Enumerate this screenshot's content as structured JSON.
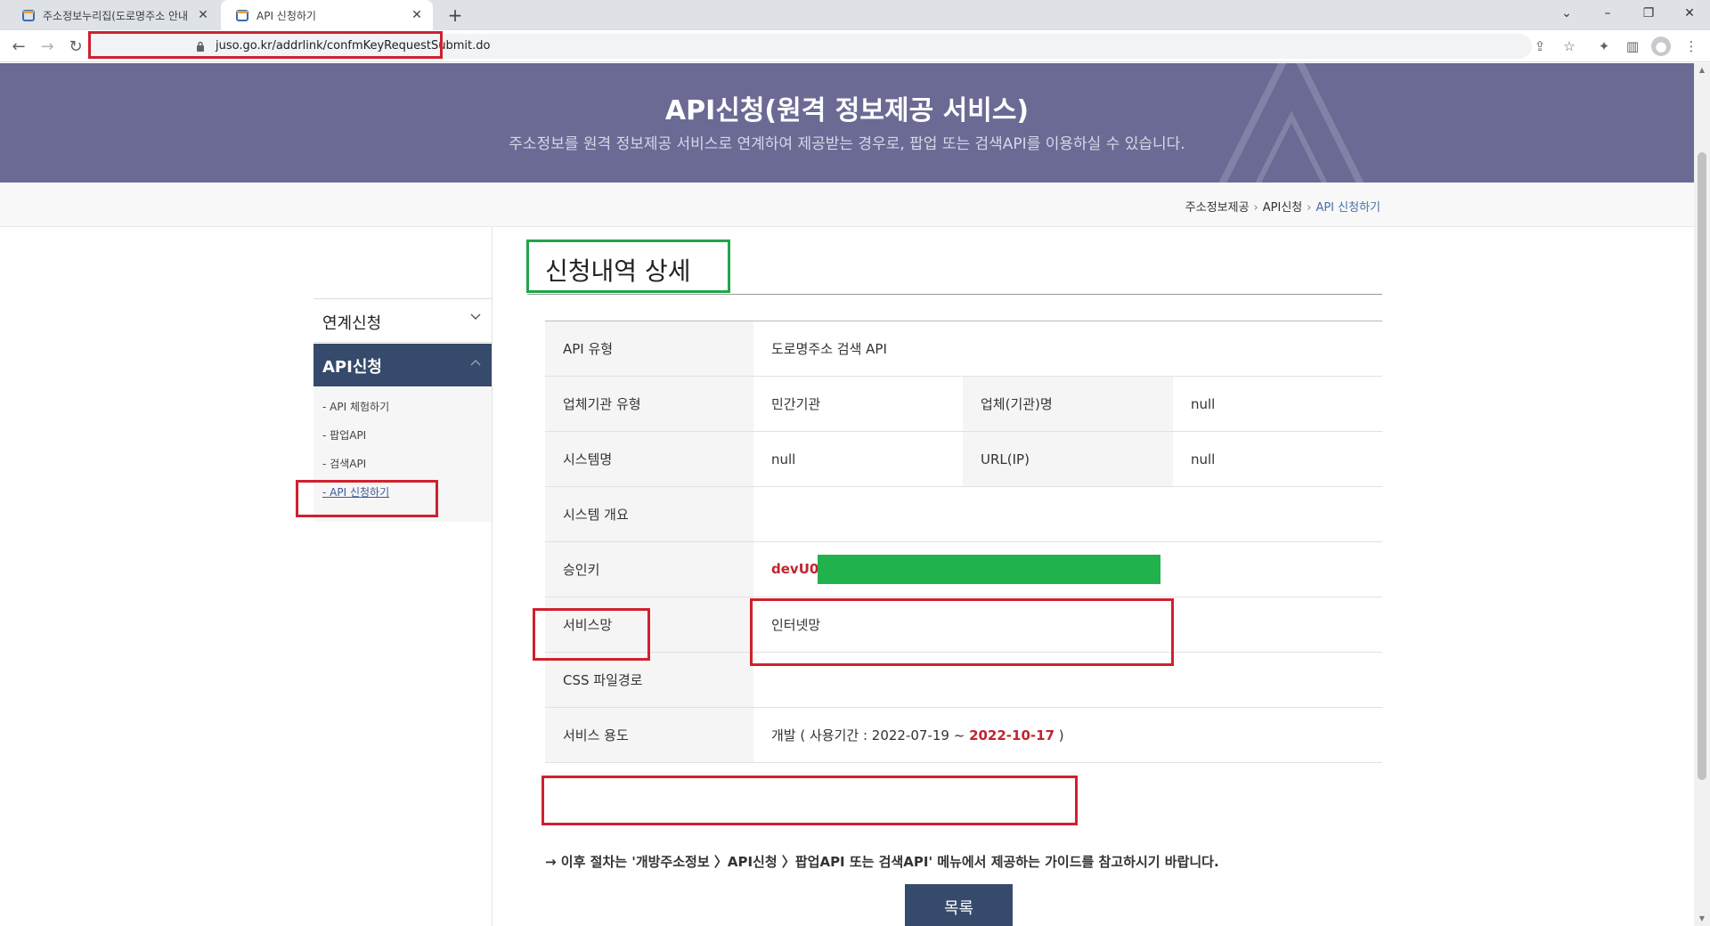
{
  "browser": {
    "tabs": [
      {
        "title": "주소정보누리집(도로명주소 안내",
        "active": false
      },
      {
        "title": "API 신청하기",
        "active": true
      }
    ],
    "url": "juso.go.kr/addrlink/confmKeyRequestSubmit.do"
  },
  "hero": {
    "title": "API신청(원격 정보제공 서비스)",
    "subtitle": "주소정보를 원격 정보제공 서비스로 연계하여 제공받는 경우로, 팝업 또는 검색API를 이용하실 수 있습니다."
  },
  "breadcrumb": [
    "주소정보제공",
    "API신청",
    "API 신청하기"
  ],
  "sidebar": {
    "menu1": "연계신청",
    "menu2": "API신청",
    "sub_items": [
      "API 체험하기",
      "팝업API",
      "검색API",
      "API 신청하기"
    ]
  },
  "main": {
    "title": "신청내역 상세",
    "rows": {
      "api_type_label": "API 유형",
      "api_type_value": "도로명주소 검색 API",
      "org_type_label": "업체기관 유형",
      "org_type_value": "민간기관",
      "org_name_label": "업체(기관)명",
      "org_name_value": "null",
      "system_name_label": "시스템명",
      "system_name_value": "null",
      "url_label": "URL(IP)",
      "url_value": "null",
      "system_overview_label": "시스템 개요",
      "approval_key_label": "승인키",
      "approval_key_value": "devU0",
      "network_label": "서비스망",
      "network_value": "인터넷망",
      "css_path_label": "CSS 파일경로",
      "usage_label": "서비스 용도",
      "usage_prefix": "개발 ( 사용기간 : 2022-07-19 ~ ",
      "usage_end": "2022-10-17",
      "usage_suffix": " )"
    },
    "guide_note": "→ 이후 절차는 '개방주소정보 〉API신청 〉팝업API 또는 검색API' 메뉴에서 제공하는 가이드를 참고하시기 바랍니다.",
    "list_button": "목록"
  },
  "colors": {
    "hero_bg": "#6b6a95",
    "navy": "#364a6b",
    "highlight_red": "#d0202e",
    "highlight_green": "#21a54a",
    "key_red": "#c0242f"
  }
}
